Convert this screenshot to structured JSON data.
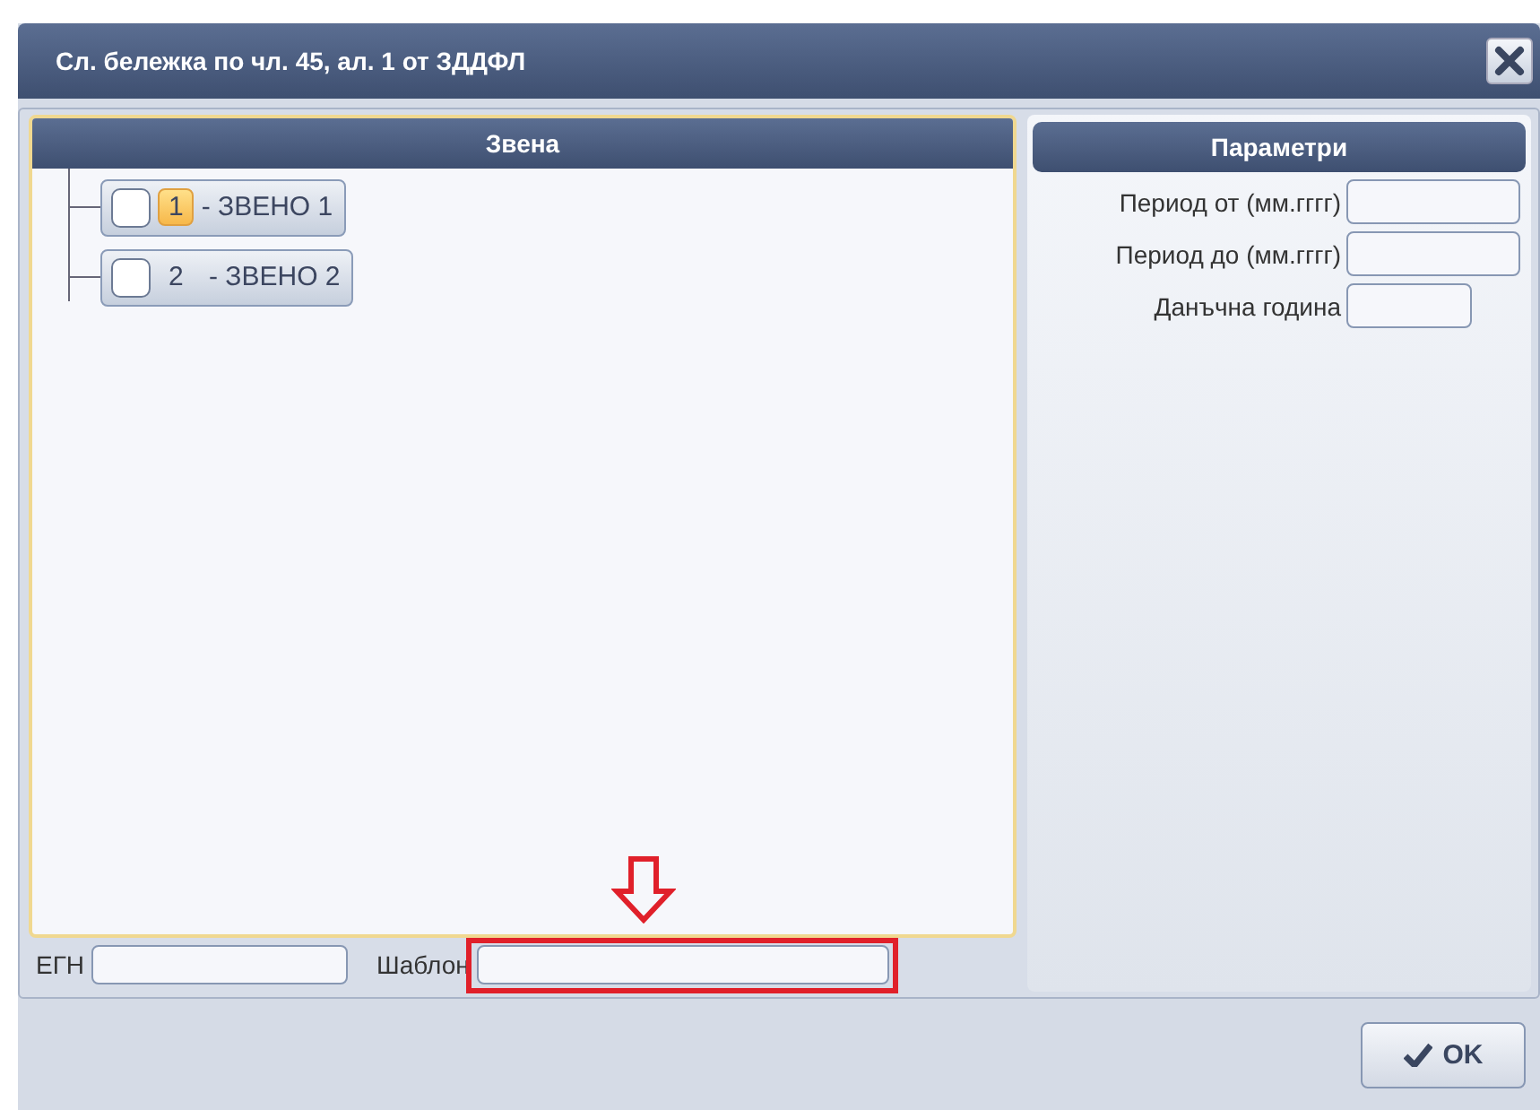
{
  "window": {
    "title": "Сл. бележка по чл. 45, ал. 1 от ЗДДФЛ"
  },
  "units_panel": {
    "title": "Звена",
    "items": [
      {
        "number": "1",
        "label": "- ЗВЕНО 1",
        "checked": false,
        "highlighted": true
      },
      {
        "number": "2",
        "label": " - ЗВЕНО 2",
        "checked": false,
        "highlighted": false
      }
    ]
  },
  "filters": [
    {
      "label": "ЕГН",
      "annotated": false
    },
    {
      "label": "Шаблон",
      "annotated": true
    }
  ],
  "params_panel": {
    "title": "Параметри",
    "fields": [
      {
        "label": "Период от (мм.гггг)"
      },
      {
        "label": "Период до (мм.гггг)"
      },
      {
        "label": "Данъчна година"
      }
    ]
  },
  "buttons": [
    {
      "label": "OK"
    }
  ]
}
